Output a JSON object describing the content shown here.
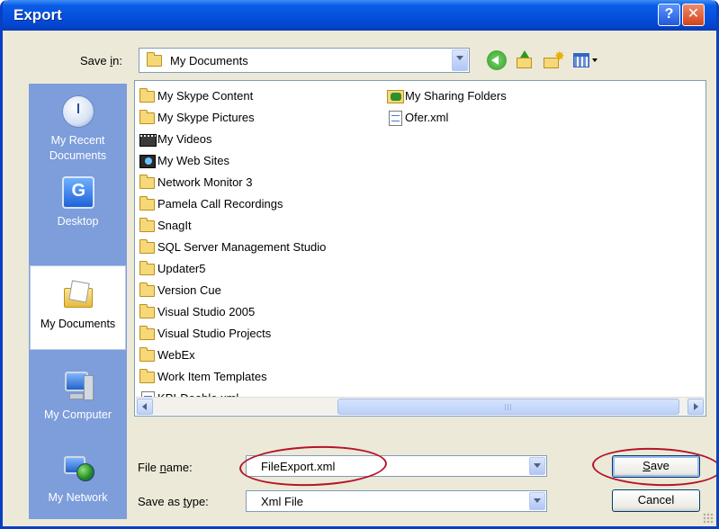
{
  "window": {
    "title": "Export",
    "help_glyph": "?",
    "close_glyph": "✕"
  },
  "save_in": {
    "label_pre": "Save ",
    "label_ul": "i",
    "label_post": "n:",
    "value": "My Documents"
  },
  "toolbar": {
    "icons": [
      "back-icon",
      "up-folder-icon",
      "new-folder-icon",
      "views-menu-icon"
    ]
  },
  "places": [
    {
      "label": "My Recent Documents",
      "icon": "recent-documents-icon"
    },
    {
      "label": "Desktop",
      "icon": "desktop-icon"
    },
    {
      "label": "My Documents",
      "icon": "my-documents-icon",
      "selected": true
    },
    {
      "label": "My Computer",
      "icon": "my-computer-icon"
    },
    {
      "label": "My Network",
      "icon": "my-network-icon"
    }
  ],
  "files": {
    "column1": [
      {
        "name": "My Skype Content",
        "type": "folder"
      },
      {
        "name": "My Skype Pictures",
        "type": "folder"
      },
      {
        "name": "My Videos",
        "type": "video-folder"
      },
      {
        "name": "My Web Sites",
        "type": "web-folder"
      },
      {
        "name": "Network Monitor 3",
        "type": "folder"
      },
      {
        "name": "Pamela Call Recordings",
        "type": "folder"
      },
      {
        "name": "SnagIt",
        "type": "folder"
      },
      {
        "name": "SQL Server Management Studio",
        "type": "folder"
      },
      {
        "name": "Updater5",
        "type": "folder"
      },
      {
        "name": "Version Cue",
        "type": "folder"
      },
      {
        "name": "Visual Studio 2005",
        "type": "folder"
      },
      {
        "name": "Visual Studio Projects",
        "type": "folder"
      },
      {
        "name": "WebEx",
        "type": "folder"
      },
      {
        "name": "Work Item Templates",
        "type": "folder"
      },
      {
        "name": "KPI-Dooblo.xml",
        "type": "xml"
      }
    ],
    "column2": [
      {
        "name": "My Sharing Folders",
        "type": "shared-folder"
      },
      {
        "name": "Ofer.xml",
        "type": "xml"
      }
    ]
  },
  "file_name": {
    "label_pre": "File ",
    "label_ul": "n",
    "label_post": "ame:",
    "value": "FileExport.xml"
  },
  "save_as_type": {
    "label_pre": "Save as ",
    "label_ul": "t",
    "label_post": "ype:",
    "value": "Xml File"
  },
  "buttons": {
    "save_ul": "S",
    "save_rest": "ave",
    "cancel": "Cancel"
  },
  "colors": {
    "title_bar": "#0550dd",
    "places_bar": "#7d9ddb",
    "dialog_bg": "#ece9d8",
    "annotation_ellipse": "#b3152b"
  }
}
